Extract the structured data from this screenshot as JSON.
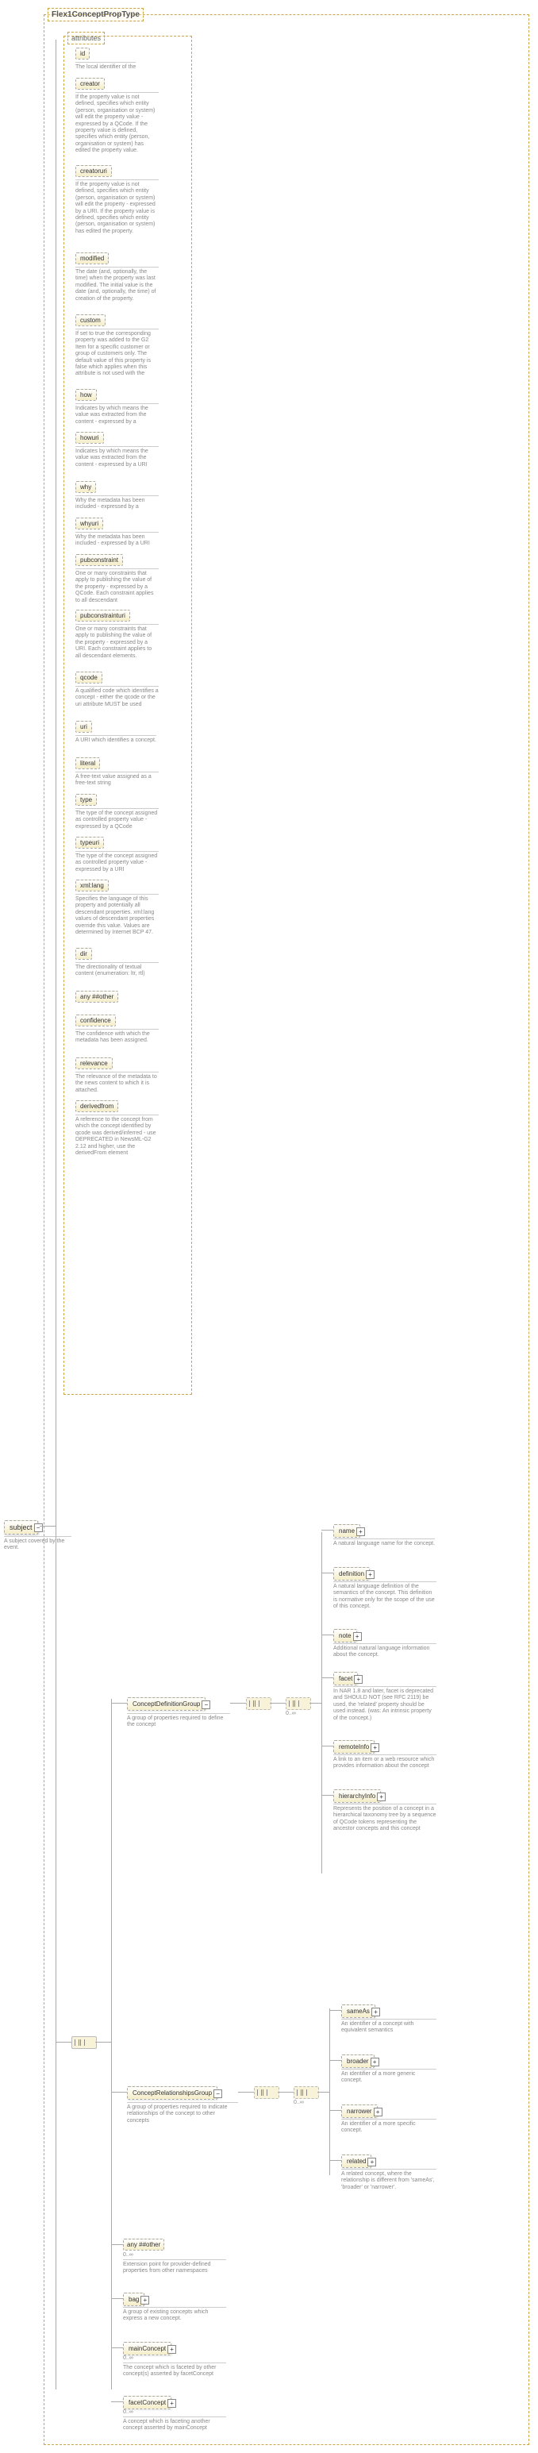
{
  "type_name": "Flex1ConceptPropType",
  "attributes_label": "attributes",
  "subject": {
    "label": "subject",
    "desc": "A subject covered by the event."
  },
  "attrs": [
    {
      "name": "id",
      "desc": "The local identifier of the"
    },
    {
      "name": "creator",
      "desc": "If the property value is not defined, specifies which entity (person, organisation or system) will edit the property value - expressed by a QCode. If the property value is defined, specifies which entity (person, organisation or system) has edited the property value."
    },
    {
      "name": "creatoruri",
      "desc": "If the property value is not defined, specifies which entity (person, organisation or system) will edit the property - expressed by a URI. If the property value is defined, specifies which entity (person, organisation or system) has edited the property."
    },
    {
      "name": "modified",
      "desc": "The date (and, optionally, the time) when the property was last modified. The initial value is the date (and, optionally, the time) of creation of the property."
    },
    {
      "name": "custom",
      "desc": "If set to true the corresponding property was added to the G2 Item for a specific customer or group of customers only. The default value of this property is false which applies when this attribute is not used with the"
    },
    {
      "name": "how",
      "desc": "Indicates by which means the value was extracted from the content - expressed by a"
    },
    {
      "name": "howuri",
      "desc": "Indicates by which means the value was extracted from the content - expressed by a URI"
    },
    {
      "name": "why",
      "desc": "Why the metadata has been included - expressed by a"
    },
    {
      "name": "whyuri",
      "desc": "Why the metadata has been included - expressed by a URI"
    },
    {
      "name": "pubconstraint",
      "desc": "One or many constraints that apply to publishing the value of the property - expressed by a QCode. Each constraint applies to all descendant"
    },
    {
      "name": "pubconstrainturi",
      "desc": "One or many constraints that apply to publishing the value of the property - expressed by a URI. Each constraint applies to all descendant elements."
    },
    {
      "name": "qcode",
      "desc": "A qualified code which identifies a concept - either the qcode or the uri attribute MUST be used"
    },
    {
      "name": "uri",
      "desc": "A URI which identifies a concept."
    },
    {
      "name": "literal",
      "desc": "A free-text value assigned as a free-text string"
    },
    {
      "name": "type",
      "desc": "The type of the concept assigned as controlled property value - expressed by a QCode"
    },
    {
      "name": "typeuri",
      "desc": "The type of the concept assigned as controlled property value - expressed by a URI"
    },
    {
      "name": "xml:lang",
      "desc": "Specifies the language of this property and potentially all descendant properties. xml:lang values of descendant properties override this value. Values are determined by Internet BCP 47."
    },
    {
      "name": "dir",
      "desc": "The directionality of textual content (enumeration: ltr, rtl)"
    },
    {
      "name": "any ##other",
      "desc": ""
    },
    {
      "name": "confidence",
      "desc": "The confidence with which the metadata has been assigned."
    },
    {
      "name": "relevance",
      "desc": "The relevance of the metadata to the news content to which it is attached."
    },
    {
      "name": "derivedfrom",
      "desc": "A reference to the concept from which the concept identified by qcode was derived/inferred - use DEPRECATED in NewsML-G2 2.12 and higher, use the derivedFrom element"
    }
  ],
  "groups": [
    {
      "name": "ConceptDefinitionGroup",
      "desc": "A group of properties required to define the concept",
      "card": "0..∞"
    },
    {
      "name": "ConceptRelationshipsGroup",
      "desc": "A group of properties required to indicate relationships of the concept to other concepts",
      "card": "0..∞"
    }
  ],
  "defElems": [
    {
      "name": "name",
      "desc": "A natural language name for the concept."
    },
    {
      "name": "definition",
      "desc": "A natural language definition of the semantics of the concept. This definition is normative only for the scope of the use of this concept."
    },
    {
      "name": "note",
      "desc": "Additional natural language information about the concept."
    },
    {
      "name": "facet",
      "desc": "In NAR 1.8 and later, facet is deprecated and SHOULD NOT (see RFC 2119) be used, the 'related' property should be used instead. (was: An intrinsic property of the concept.)"
    },
    {
      "name": "remoteInfo",
      "desc": "A link to an item or a web resource which provides information about the concept"
    },
    {
      "name": "hierarchyInfo",
      "desc": "Represents the position of a concept in a hierarchical taxonomy tree by a sequence of QCode tokens representing the ancestor concepts and this concept"
    }
  ],
  "relElems": [
    {
      "name": "sameAs",
      "desc": "An identifier of a concept with equivalent semantics"
    },
    {
      "name": "broader",
      "desc": "An identifier of a more generic concept."
    },
    {
      "name": "narrower",
      "desc": "An identifier of a more specific concept."
    },
    {
      "name": "related",
      "desc": "A related concept, where the relationship is different from 'sameAs', 'broader' or 'narrower'."
    }
  ],
  "bottomElems": [
    {
      "name": "any ##other",
      "desc": "Extension point for provider-defined properties from other namespaces",
      "card": "0..∞"
    },
    {
      "name": "bag",
      "desc": "A group of existing concepts which express a new concept."
    },
    {
      "name": "mainConcept",
      "desc": "The concept which is faceted by other concept(s) asserted by facetConcept",
      "card": "0..∞"
    },
    {
      "name": "facetConcept",
      "desc": "A concept which is faceting another concept asserted by mainConcept",
      "card": "0..∞"
    }
  ]
}
